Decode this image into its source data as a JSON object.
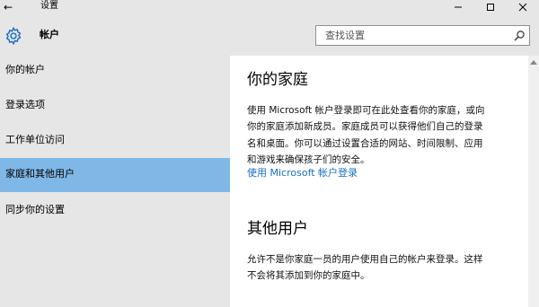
{
  "window": {
    "back_icon": "←",
    "title": "设置",
    "controls": {
      "minimize": "—",
      "maximize": "☐",
      "close": "✕"
    }
  },
  "header": {
    "icon": "gear-icon",
    "title": "帐户",
    "search_placeholder": "查找设置",
    "search_icon": "search-icon"
  },
  "sidebar": {
    "items": [
      {
        "label": "你的帐户",
        "selected": false
      },
      {
        "label": "登录选项",
        "selected": false
      },
      {
        "label": "工作单位访问",
        "selected": false
      },
      {
        "label": "家庭和其他用户",
        "selected": true
      },
      {
        "label": "同步你的设置",
        "selected": false
      }
    ]
  },
  "main": {
    "family": {
      "heading": "你的家庭",
      "lines": [
        "使用 Microsoft 帐户登录即可在此处查看你的家庭，或向",
        "你的家庭添加新成员。家庭成员可以获得他们自己的登录",
        "名和桌面。你可以通过设置合适的网站、时间限制、应用",
        "和游戏来确保孩子们的安全。"
      ],
      "link": "使用 Microsoft 帐户登录"
    },
    "others": {
      "heading": "其他用户",
      "lines": [
        "允许不是你家庭一员的用户使用自己的帐户来登录。这样",
        "不会将其添加到你的家庭中。"
      ]
    }
  },
  "colors": {
    "accent": "#7fb8e6",
    "link": "#1a6fc4",
    "chrome": "#e6e6e6"
  }
}
